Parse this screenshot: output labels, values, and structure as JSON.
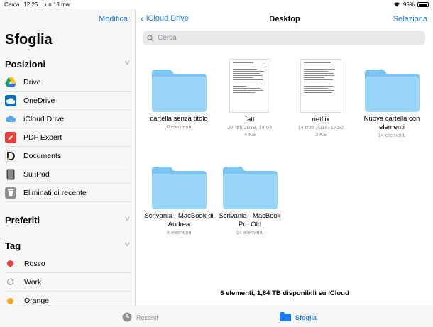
{
  "status": {
    "carrier": "Cerca",
    "time": "12:25",
    "date": "Lun 18 mar",
    "battery": "95%"
  },
  "sidebar": {
    "edit_label": "Modifica",
    "title": "Sfoglia",
    "positions_header": "Posizioni",
    "locations": [
      {
        "label": "Drive",
        "icon": "google-drive-icon"
      },
      {
        "label": "OneDrive",
        "icon": "onedrive-icon"
      },
      {
        "label": "iCloud Drive",
        "icon": "icloud-icon"
      },
      {
        "label": "PDF Expert",
        "icon": "pdf-expert-icon"
      },
      {
        "label": "Documents",
        "icon": "documents-icon"
      },
      {
        "label": "Su iPad",
        "icon": "ipad-icon"
      },
      {
        "label": "Eliminati di recente",
        "icon": "trash-icon"
      }
    ],
    "favorites_header": "Preferiti",
    "tags_header": "Tag",
    "tags": [
      {
        "label": "Rosso",
        "color": "#e8413c"
      },
      {
        "label": "Work",
        "color": "#ffffff"
      },
      {
        "label": "Orange",
        "color": "#f5a623"
      }
    ]
  },
  "main": {
    "back_label": "iCloud Drive",
    "title": "Desktop",
    "select_label": "Seleziona",
    "search_placeholder": "Cerca",
    "items": [
      {
        "name": "cartella senza titolo",
        "meta1": "0 elementi",
        "meta2": "",
        "kind": "folder"
      },
      {
        "name": "fatt",
        "meta1": "27 feb 2019, 14:04",
        "meta2": "4 KB",
        "kind": "doc"
      },
      {
        "name": "netflix",
        "meta1": "14 mar 2019, 17:52",
        "meta2": "3 KB",
        "kind": "doc"
      },
      {
        "name": "Nuova cartella con elementi",
        "meta1": "14 elementi",
        "meta2": "",
        "kind": "folder"
      },
      {
        "name": "Scrivania - MacBook di Andrea",
        "meta1": "8 elementi",
        "meta2": "",
        "kind": "folder"
      },
      {
        "name": "Scrivania - MacBook Pro Old",
        "meta1": "14 elementi",
        "meta2": "",
        "kind": "folder"
      }
    ],
    "footer": "6 elementi, 1,84 TB disponibili su iCloud"
  },
  "tabbar": {
    "recent_label": "Recenti",
    "browse_label": "Sfoglia"
  },
  "colors": {
    "accent": "#1a7cf5",
    "folder": "#8fd0f7"
  }
}
